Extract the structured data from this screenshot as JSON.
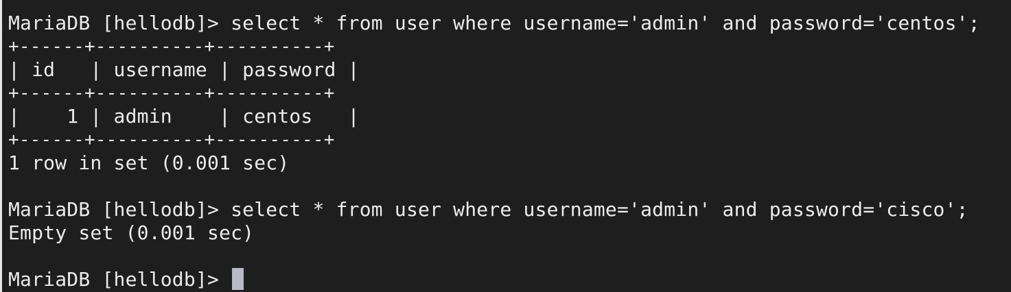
{
  "terminal": {
    "query1": {
      "prompt": "MariaDB [hellodb]> ",
      "command": "select * from user where username='admin' and password='centos';"
    },
    "table": {
      "border_top": "+------+----------+----------+",
      "header_row": "| id   | username | password |",
      "border_mid": "+------+----------+----------+",
      "data_row": "|    1 | admin    | centos   |",
      "border_bottom": "+------+----------+----------+",
      "columns": [
        "id",
        "username",
        "password"
      ],
      "rows": [
        [
          "1",
          "admin",
          "centos"
        ]
      ]
    },
    "result1": "1 row in set (0.001 sec)",
    "query2": {
      "prompt": "MariaDB [hellodb]> ",
      "command": "select * from user where username='admin' and password='cisco';"
    },
    "result2": "Empty set (0.001 sec)",
    "current_prompt": "MariaDB [hellodb]> "
  }
}
